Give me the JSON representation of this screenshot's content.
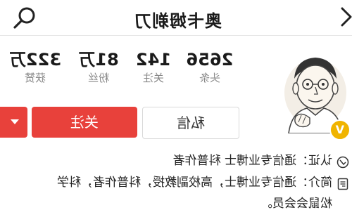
{
  "header": {
    "title": "奥卡姆剃刀"
  },
  "profile": {
    "verified_badge": "V",
    "stats": [
      {
        "value": "2656",
        "label": "头条"
      },
      {
        "value": "142",
        "label": "关注"
      },
      {
        "value": "81万",
        "label": "粉丝"
      },
      {
        "value": "322万",
        "label": "获赞"
      }
    ]
  },
  "actions": {
    "message_label": "私信",
    "follow_label": "关注"
  },
  "info": {
    "certification": "认证：通信专业博士 科普作者",
    "intro_line1": "简介：通信专业博士，高校副教授，科普作者，科学",
    "intro_line2": "松鼠会会员。"
  },
  "colors": {
    "accent": "#e8413b",
    "badge": "#f0b400",
    "muted_text": "#888888"
  }
}
